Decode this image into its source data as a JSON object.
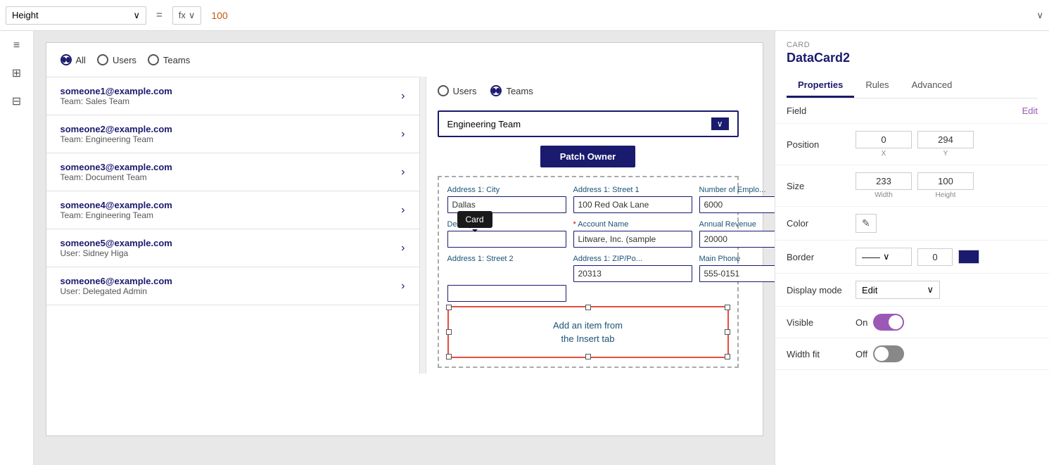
{
  "formulaBar": {
    "selectorLabel": "Height",
    "equalsSign": "=",
    "fxLabel": "fx",
    "fxChevron": "∨",
    "value": "100"
  },
  "sidebar": {
    "icons": [
      "≡",
      "⊞",
      "⊟"
    ]
  },
  "canvas": {
    "radioGroup": {
      "options": [
        "All",
        "Users",
        "Teams"
      ],
      "selected": "All"
    },
    "users": [
      {
        "email": "someone1@example.com",
        "team": "Team: Sales Team"
      },
      {
        "email": "someone2@example.com",
        "team": "Team: Engineering Team"
      },
      {
        "email": "someone3@example.com",
        "team": "Team: Document Team"
      },
      {
        "email": "someone4@example.com",
        "team": "Team: Engineering Team"
      },
      {
        "email": "someone5@example.com",
        "team": "User: Sidney Higa"
      },
      {
        "email": "someone6@example.com",
        "team": "User: Delegated Admin"
      }
    ],
    "teamPanel": {
      "innerRadio": {
        "options": [
          "Users",
          "Teams"
        ],
        "selected": "Teams"
      },
      "dropdownValue": "Engineering Team",
      "patchOwnerBtn": "Patch Owner",
      "fields": [
        {
          "label": "Address 1: City",
          "value": "Dallas",
          "required": false
        },
        {
          "label": "Address 1: Street 1",
          "value": "100 Red Oak Lane",
          "required": false
        },
        {
          "label": "Number of Emplo...",
          "value": "6000",
          "required": false
        },
        {
          "label": "Description",
          "value": "",
          "required": false
        },
        {
          "label": "Account Name",
          "value": "Litware, Inc. (sample",
          "required": true
        },
        {
          "label": "Annual Revenue",
          "value": "20000",
          "required": false
        },
        {
          "label": "Address 1: Street 2",
          "value": "",
          "required": false
        },
        {
          "label": "Address 1: ZIP/Po...",
          "value": "20313",
          "required": false
        },
        {
          "label": "Main Phone",
          "value": "555-0151",
          "required": false
        }
      ],
      "cardTooltip": "Card",
      "cardPlaceholder": "Add an item from\nthe Insert tab"
    }
  },
  "propsPanel": {
    "cardLabel": "CARD",
    "title": "DataCard2",
    "tabs": [
      "Properties",
      "Rules",
      "Advanced"
    ],
    "activeTab": "Properties",
    "field": {
      "label": "Field",
      "editLabel": "Edit"
    },
    "position": {
      "label": "Position",
      "x": "0",
      "y": "294",
      "xLabel": "X",
      "yLabel": "Y"
    },
    "size": {
      "label": "Size",
      "width": "233",
      "height": "100",
      "widthLabel": "Width",
      "heightLabel": "Height"
    },
    "color": {
      "label": "Color"
    },
    "border": {
      "label": "Border",
      "value": "0"
    },
    "displayMode": {
      "label": "Display mode",
      "value": "Edit"
    },
    "visible": {
      "label": "Visible",
      "state": "On"
    },
    "widthFit": {
      "label": "Width fit",
      "state": "Off"
    }
  }
}
